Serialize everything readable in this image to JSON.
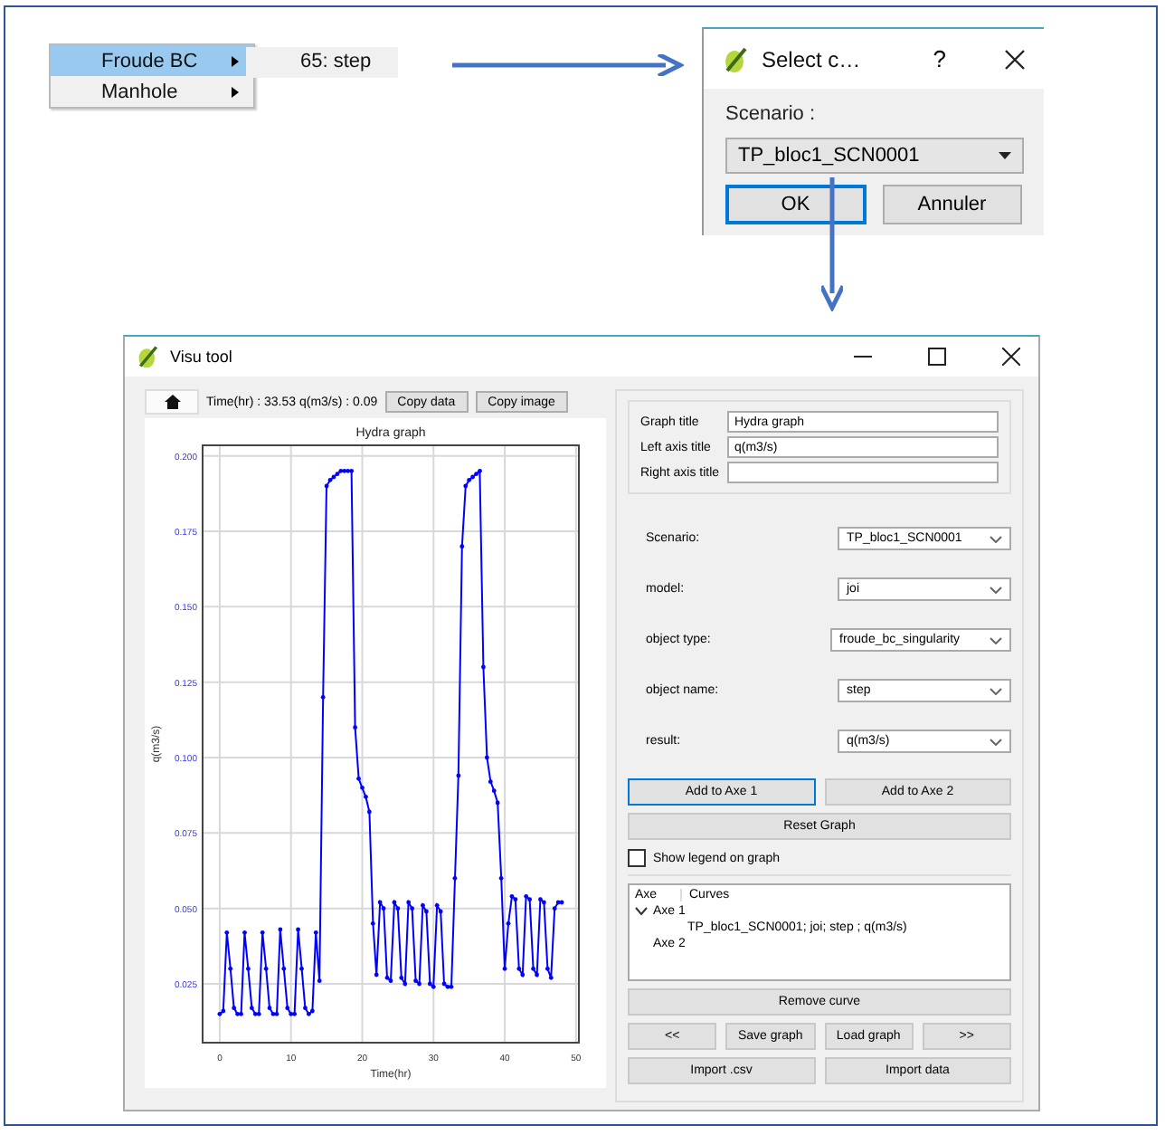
{
  "context_menu": {
    "items": [
      {
        "label": "Froude BC",
        "selected": true
      },
      {
        "label": "Manhole",
        "selected": false
      }
    ]
  },
  "submenu": {
    "items": [
      {
        "label": "65: step"
      }
    ]
  },
  "select_dialog": {
    "title": "Select c…",
    "help": "?",
    "scenario_label": "Scenario :",
    "scenario_value": "TP_bloc1_SCN0001",
    "buttons": [
      {
        "label": "OK",
        "focused": true
      },
      {
        "label": "Annuler",
        "focused": false
      }
    ]
  },
  "visu_window": {
    "title": "Visu tool",
    "toolbar": {
      "readout": "Time(hr) : 33.53  q(m3/s) : 0.09",
      "buttons": [
        "Copy data",
        "Copy image"
      ]
    },
    "chart_data": {
      "type": "line",
      "title": "Hydra graph",
      "xlabel": "Time(hr)",
      "ylabel": "q(m3/s)",
      "xlim": [
        -2.4,
        50.4
      ],
      "ylim": [
        0.0055,
        0.2035
      ],
      "xticks": [
        0,
        10,
        20,
        30,
        40,
        50
      ],
      "yticks": [
        {
          "value": 0.025,
          "label": "0.025"
        },
        {
          "value": 0.05,
          "label": "0.050"
        },
        {
          "value": 0.075,
          "label": "0.075"
        },
        {
          "value": 0.1,
          "label": "0.100"
        },
        {
          "value": 0.125,
          "label": "0.125"
        },
        {
          "value": 0.15,
          "label": "0.150"
        },
        {
          "value": 0.175,
          "label": "0.175"
        },
        {
          "value": 0.2,
          "label": "0.200"
        }
      ],
      "x": [
        0,
        0.5,
        1,
        1.5,
        2,
        2.5,
        3,
        3.5,
        4,
        4.5,
        5,
        5.5,
        6,
        6.5,
        7,
        7.5,
        8,
        8.5,
        9,
        9.5,
        10,
        10.5,
        11,
        11.5,
        12,
        12.5,
        13,
        13.5,
        14,
        14.5,
        15,
        15.5,
        16,
        16.5,
        17,
        17.5,
        18,
        18.5,
        19,
        19.5,
        20,
        20.5,
        21,
        21.5,
        22,
        22.5,
        23,
        23.5,
        24,
        24.5,
        25,
        25.5,
        26,
        26.5,
        27,
        27.5,
        28,
        28.5,
        29,
        29.5,
        30,
        30.5,
        31,
        31.5,
        32,
        32.5,
        33,
        33.5,
        34,
        34.5,
        35,
        35.5,
        36,
        36.5,
        37,
        37.5,
        38,
        38.5,
        39,
        39.5,
        40,
        40.5,
        41,
        41.5,
        42,
        42.5,
        43,
        43.5,
        44,
        44.5,
        45,
        45.5,
        46,
        46.5,
        47,
        47.5,
        48
      ],
      "grid": true,
      "series": [
        {
          "color": "#0000ff",
          "values": [
            0.015,
            0.016,
            0.042,
            0.03,
            0.017,
            0.015,
            0.015,
            0.042,
            0.03,
            0.017,
            0.015,
            0.015,
            0.042,
            0.03,
            0.017,
            0.015,
            0.015,
            0.043,
            0.03,
            0.017,
            0.015,
            0.015,
            0.043,
            0.03,
            0.017,
            0.015,
            0.016,
            0.042,
            0.026,
            0.12,
            0.19,
            0.192,
            0.193,
            0.194,
            0.195,
            0.195,
            0.195,
            0.195,
            0.11,
            0.093,
            0.09,
            0.087,
            0.082,
            0.045,
            0.028,
            0.052,
            0.05,
            0.027,
            0.026,
            0.052,
            0.05,
            0.027,
            0.025,
            0.052,
            0.05,
            0.026,
            0.025,
            0.051,
            0.049,
            0.025,
            0.024,
            0.051,
            0.049,
            0.025,
            0.024,
            0.024,
            0.06,
            0.094,
            0.17,
            0.19,
            0.192,
            0.193,
            0.194,
            0.195,
            0.13,
            0.1,
            0.092,
            0.089,
            0.085,
            0.06,
            0.03,
            0.045,
            0.054,
            0.053,
            0.03,
            0.028,
            0.054,
            0.053,
            0.03,
            0.028,
            0.053,
            0.052,
            0.03,
            0.027,
            0.05,
            0.052,
            0.052
          ]
        }
      ]
    },
    "settings": {
      "fields": [
        {
          "label": "Graph title",
          "value": "Hydra graph"
        },
        {
          "label": "Left axis title",
          "value": "q(m3/s)"
        },
        {
          "label": "Right axis title"
        }
      ],
      "selectors": [
        {
          "label": "Scenario:",
          "value": "TP_bloc1_SCN0001"
        },
        {
          "label": "model:",
          "value": "joi"
        },
        {
          "label": "object type:",
          "value": "froude_bc_singularity"
        },
        {
          "label": "object name:",
          "value": "step"
        },
        {
          "label": "result:",
          "value": "q(m3/s)"
        }
      ],
      "axis_buttons": [
        {
          "label": "Add to Axe 1",
          "focused": true
        },
        {
          "label": "Add to Axe 2",
          "focused": false
        }
      ],
      "reset_button": "Reset Graph",
      "legend_checkbox": {
        "label": "Show legend on graph",
        "checked": false
      },
      "curves_tree": {
        "columns": [
          "Axe",
          "Curves"
        ],
        "items": [
          {
            "label": "Axe 1",
            "expanded": true,
            "children": [
              {
                "label": "TP_bloc1_SCN0001; joi; step ; q(m3/s)"
              }
            ]
          },
          {
            "label": "Axe 2"
          }
        ]
      },
      "remove_button": "Remove curve",
      "nav_buttons": [
        "<<",
        "Save graph",
        "Load graph",
        ">>"
      ],
      "import_buttons": [
        "Import .csv",
        "Import data"
      ]
    }
  }
}
